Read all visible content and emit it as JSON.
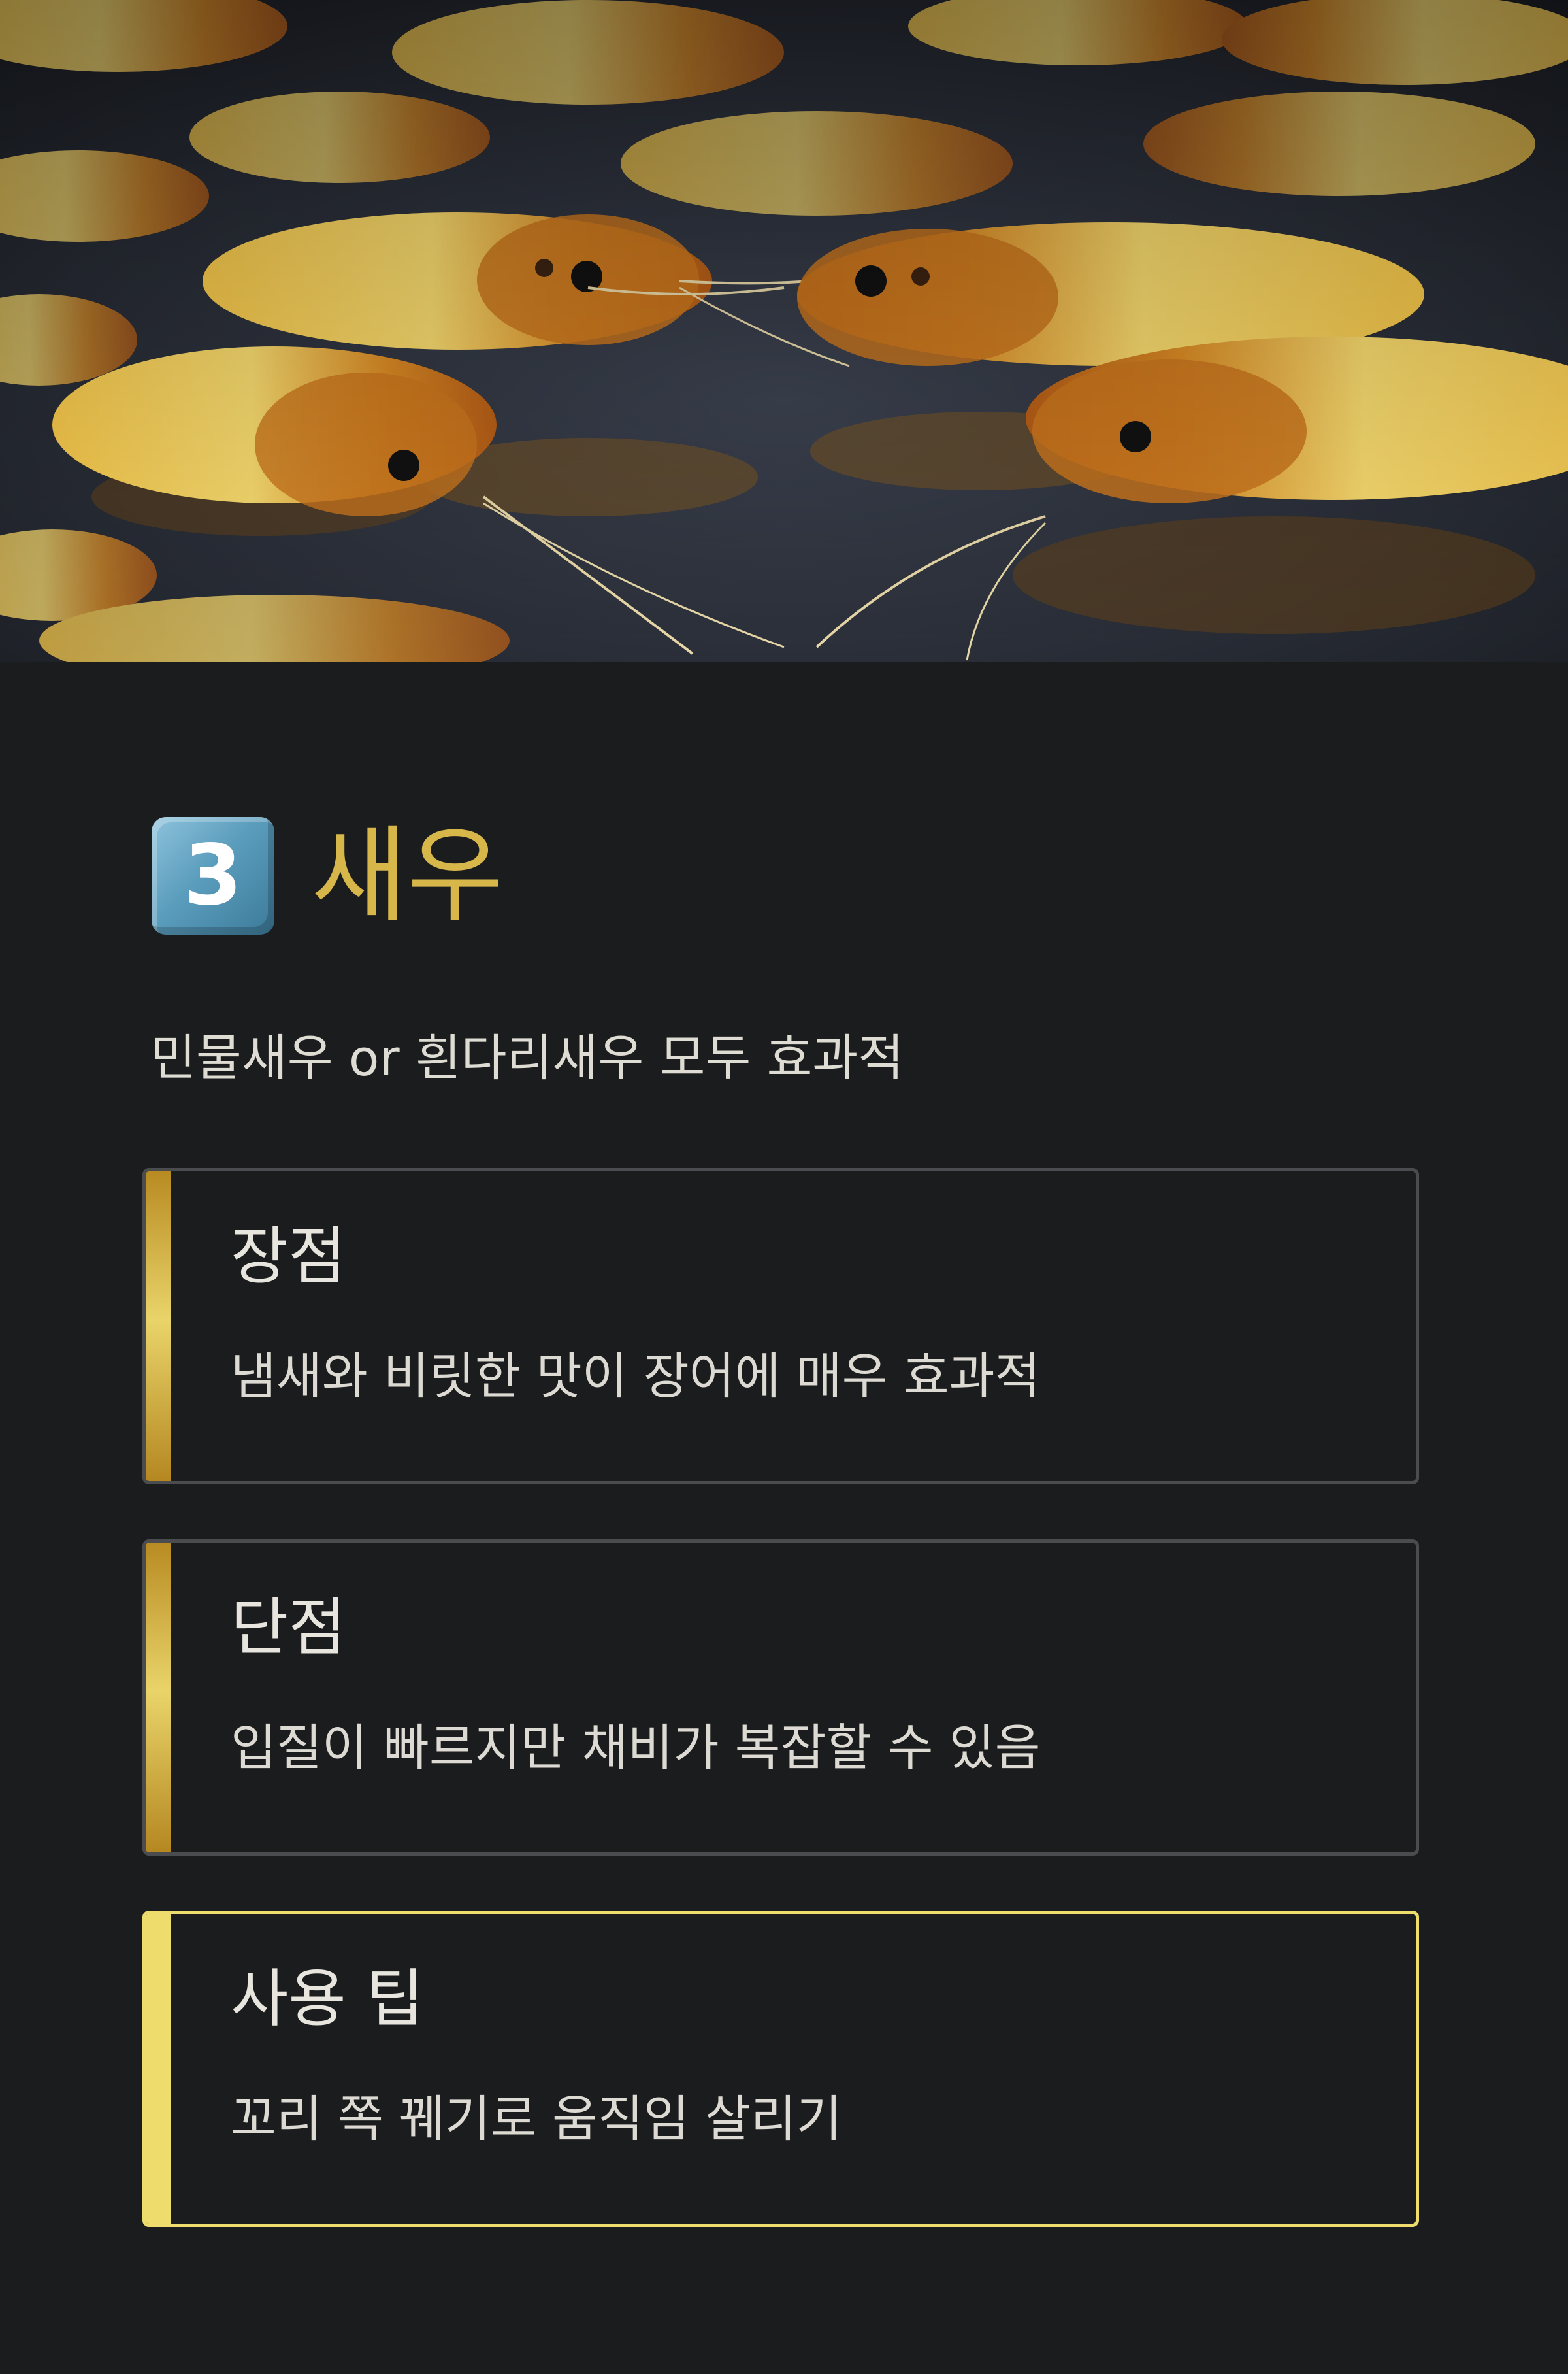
{
  "hero": {
    "image_alt": "shrimp photo"
  },
  "section": {
    "badge": "3",
    "title": "새우",
    "subtitle": "민물새우 or 흰다리새우 모두 효과적"
  },
  "cards": [
    {
      "heading": "장점",
      "text": "냄새와 비릿한 맛이 장어에 매우 효과적",
      "style": "default"
    },
    {
      "heading": "단점",
      "text": "입질이 빠르지만 채비가 복잡할 수 있음",
      "style": "default"
    },
    {
      "heading": "사용 팁",
      "text": "꼬리 쪽 꿰기로 움직임 살리기",
      "style": "highlight"
    }
  ],
  "colors": {
    "background": "#1b1c1e",
    "accent_gold": "#d8b74a",
    "highlight_border": "#eedc6c",
    "card_border": "#4a4c50",
    "text": "#dedcd3",
    "badge_blue": "#5b9dbd"
  }
}
